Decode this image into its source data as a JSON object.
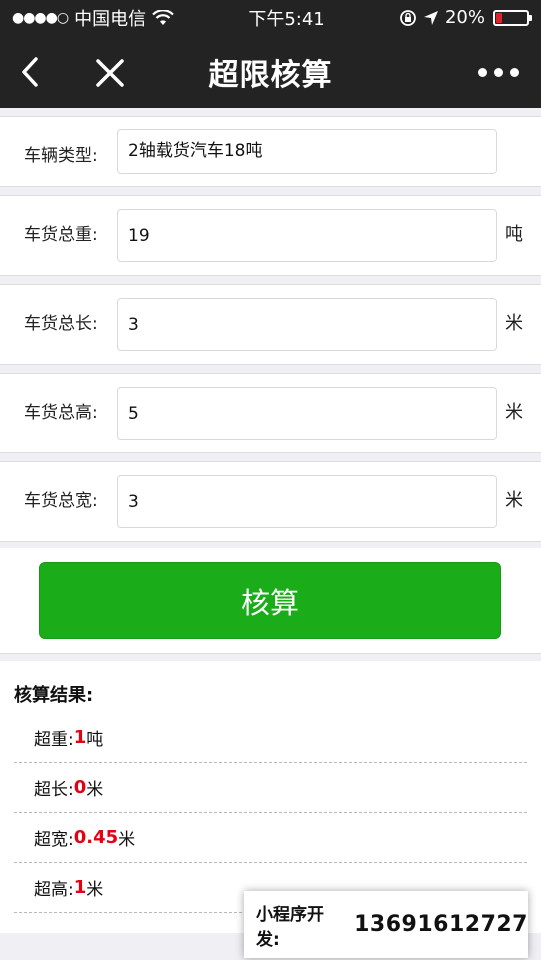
{
  "status_bar": {
    "signal": "●●●●○",
    "carrier": "中国电信",
    "time": "下午5:41",
    "battery_text": "20%",
    "battery_level": 0.2,
    "battery_color": "#e0232b"
  },
  "nav": {
    "title": "超限核算"
  },
  "form": {
    "vehicle_type": {
      "label": "车辆类型:",
      "value": "2轴载货汽车18吨"
    },
    "weight": {
      "label": "车货总重:",
      "value": "19",
      "unit": "吨"
    },
    "length": {
      "label": "车货总长:",
      "value": "3",
      "unit": "米"
    },
    "height": {
      "label": "车货总高:",
      "value": "5",
      "unit": "米"
    },
    "width": {
      "label": "车货总宽:",
      "value": "3",
      "unit": "米"
    }
  },
  "calc_button": {
    "label": "核算",
    "color": "#1aad19"
  },
  "result": {
    "title": "核算结果:",
    "items": [
      {
        "label": "超重:",
        "value": "1",
        "unit": "吨"
      },
      {
        "label": "超长:",
        "value": "0",
        "unit": "米"
      },
      {
        "label": "超宽:",
        "value": "0.45",
        "unit": "米"
      },
      {
        "label": "超高:",
        "value": "1",
        "unit": "米"
      }
    ],
    "value_color": "#e60012"
  },
  "dev_badge": {
    "label": "小程序开发:",
    "phone": "13691612727"
  }
}
